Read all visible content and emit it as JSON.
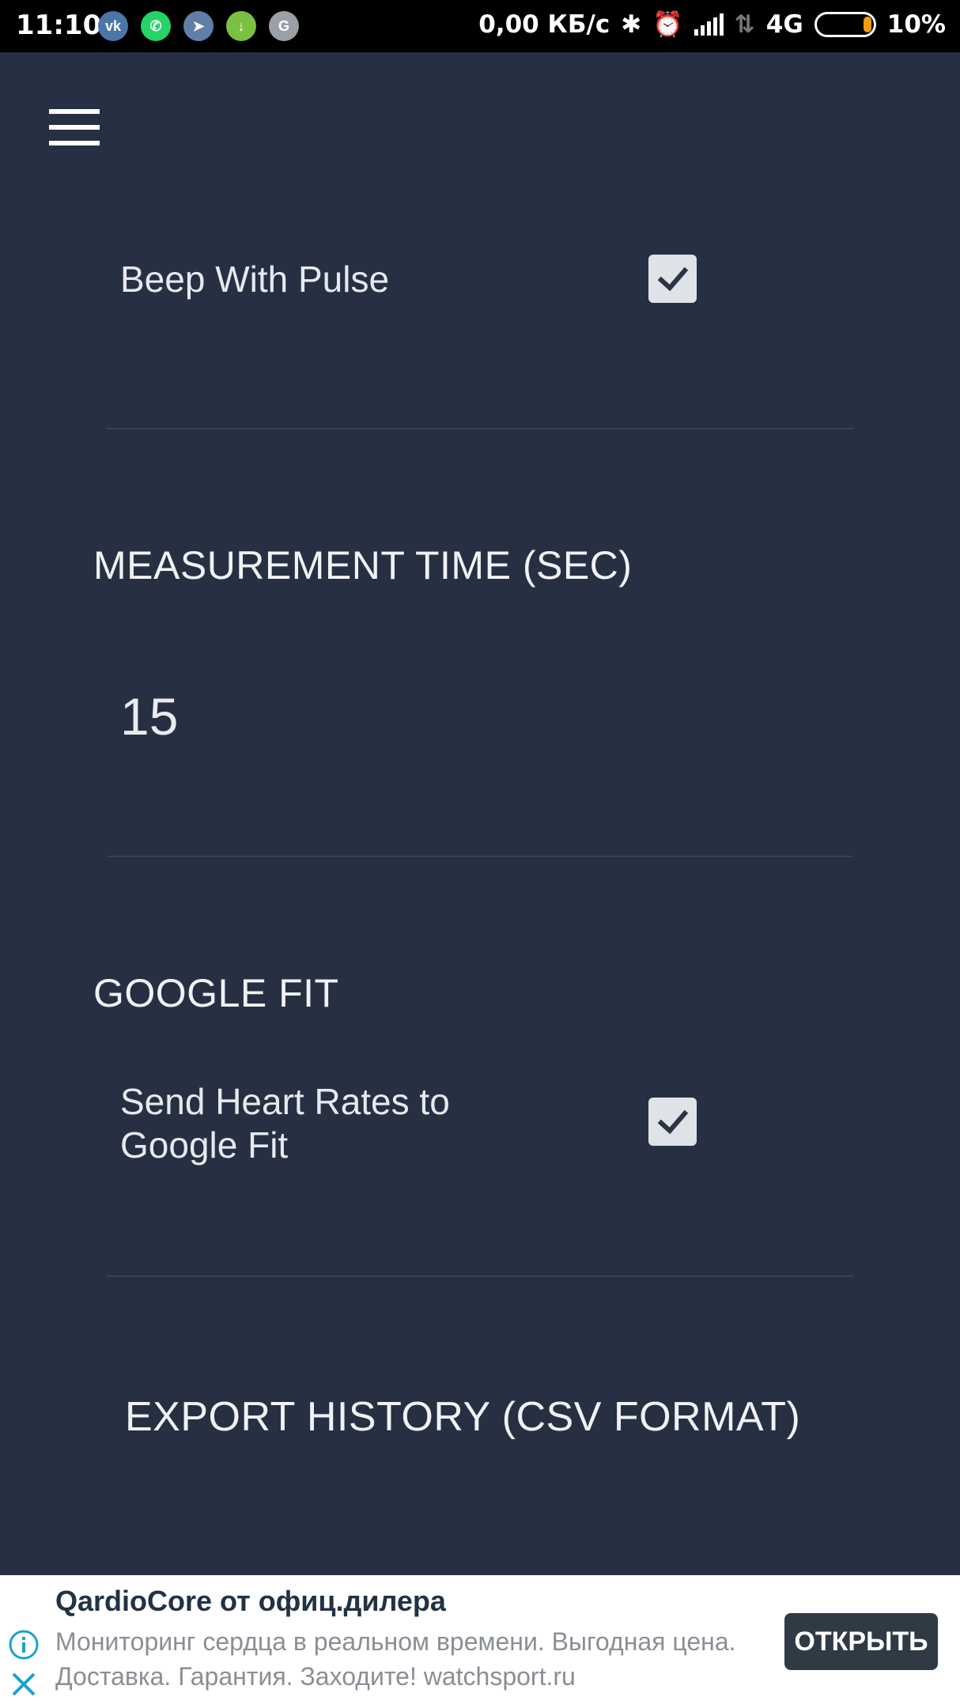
{
  "status_bar": {
    "time": "11:10",
    "apps": [
      {
        "name": "vk-icon",
        "glyph": "vk",
        "color": "#4a76a8"
      },
      {
        "name": "whatsapp-icon",
        "glyph": "✆",
        "color": "#25d366"
      },
      {
        "name": "telegram-icon",
        "glyph": "➤",
        "color": "#5f7fa6"
      },
      {
        "name": "download-icon",
        "glyph": "↓",
        "color": "#7ac143"
      },
      {
        "name": "google-icon",
        "glyph": "G",
        "color": "#9aa0a6"
      }
    ],
    "net_speed": "0,00 КБ/с",
    "network": "4G",
    "battery": "10%",
    "battery_level": 0.1
  },
  "settings": {
    "beep_with_pulse": {
      "label": "Beep With Pulse",
      "checked": true
    },
    "measurement_time": {
      "title": "MEASUREMENT TIME (SEC)",
      "value": "15"
    },
    "google_fit": {
      "title": "GOOGLE FIT",
      "send_heart_rates": {
        "label_line1": "Send Heart Rates to",
        "label_line2": "Google Fit",
        "checked": true
      }
    },
    "export": {
      "label": "EXPORT HISTORY (CSV FORMAT)"
    }
  },
  "ad": {
    "title": "QardioCore от офиц.дилера",
    "description": "Мониторинг сердца в реальном времени. Выгодная цена. Доставка. Гарантия. Заходите! watchsport.ru",
    "button": "ОТКРЫТЬ"
  }
}
